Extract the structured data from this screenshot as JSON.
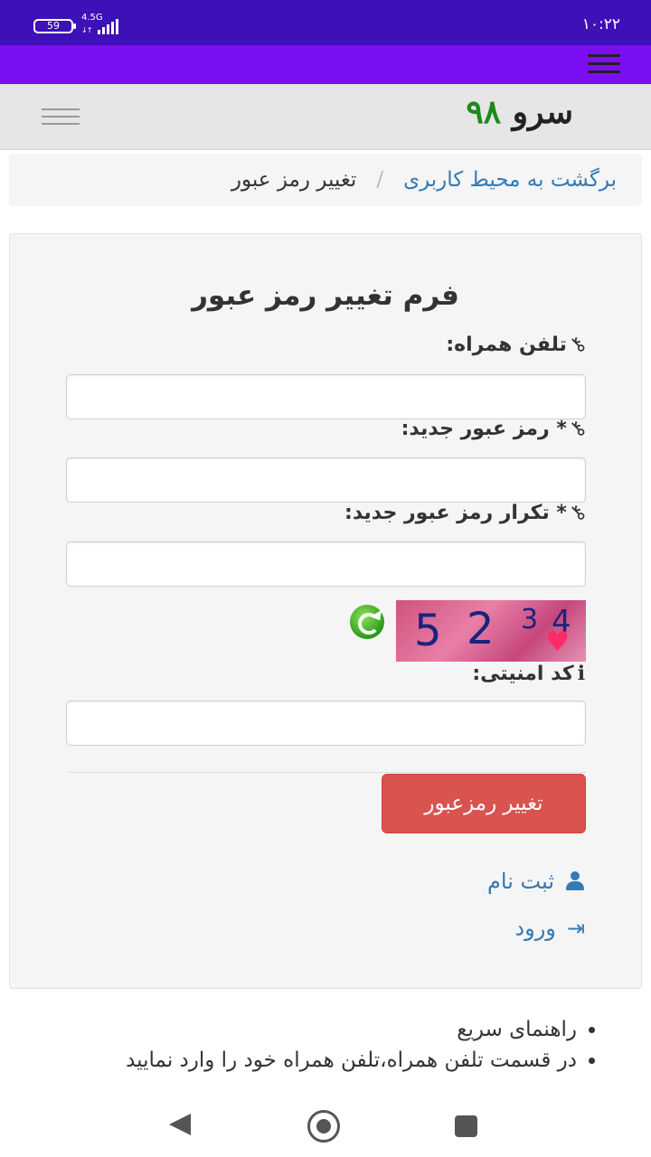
{
  "status_bar": {
    "battery": "59",
    "network": "4.5G",
    "network_arrows": "↓↑",
    "time": "۱۰:۲۲"
  },
  "header": {
    "logo_text": "سرو",
    "logo_number": "۹۸"
  },
  "breadcrumb": {
    "back_link": "برگشت به محیط کاربری",
    "separator": "/",
    "current": "تغییر رمز عبور"
  },
  "form": {
    "title": "فرم تغییر رمز عبور",
    "phone_label": "تلفن همراه:",
    "phone_value": "",
    "new_password_label": "* رمز عبور جدید:",
    "new_password_value": "",
    "repeat_password_label": "* تکرار رمز عبور جدید:",
    "repeat_password_value": "",
    "captcha_digits": [
      "5",
      "2",
      "3",
      "4"
    ],
    "security_code_label": "کد امنیتی:",
    "security_code_value": "",
    "submit_label": "تغییر رمزعبور"
  },
  "links": {
    "register": "ثبت نام",
    "login": "ورود"
  },
  "help": {
    "items": [
      "راهنمای سریع",
      "در قسمت تلفن همراه،تلفن همراه خود را وارد نمایید"
    ]
  },
  "icons": {
    "field_icon": "key-icon",
    "security_icon": "info-icon",
    "register_icon": "user-icon",
    "login_icon": "sign-in-icon",
    "captcha_refresh": "refresh-icon"
  },
  "colors": {
    "status_bar": "#3d10b8",
    "toolbar": "#7a0ff2",
    "link": "#337ab7",
    "danger_button": "#d9534f",
    "logo_number": "#1b8a1b"
  }
}
